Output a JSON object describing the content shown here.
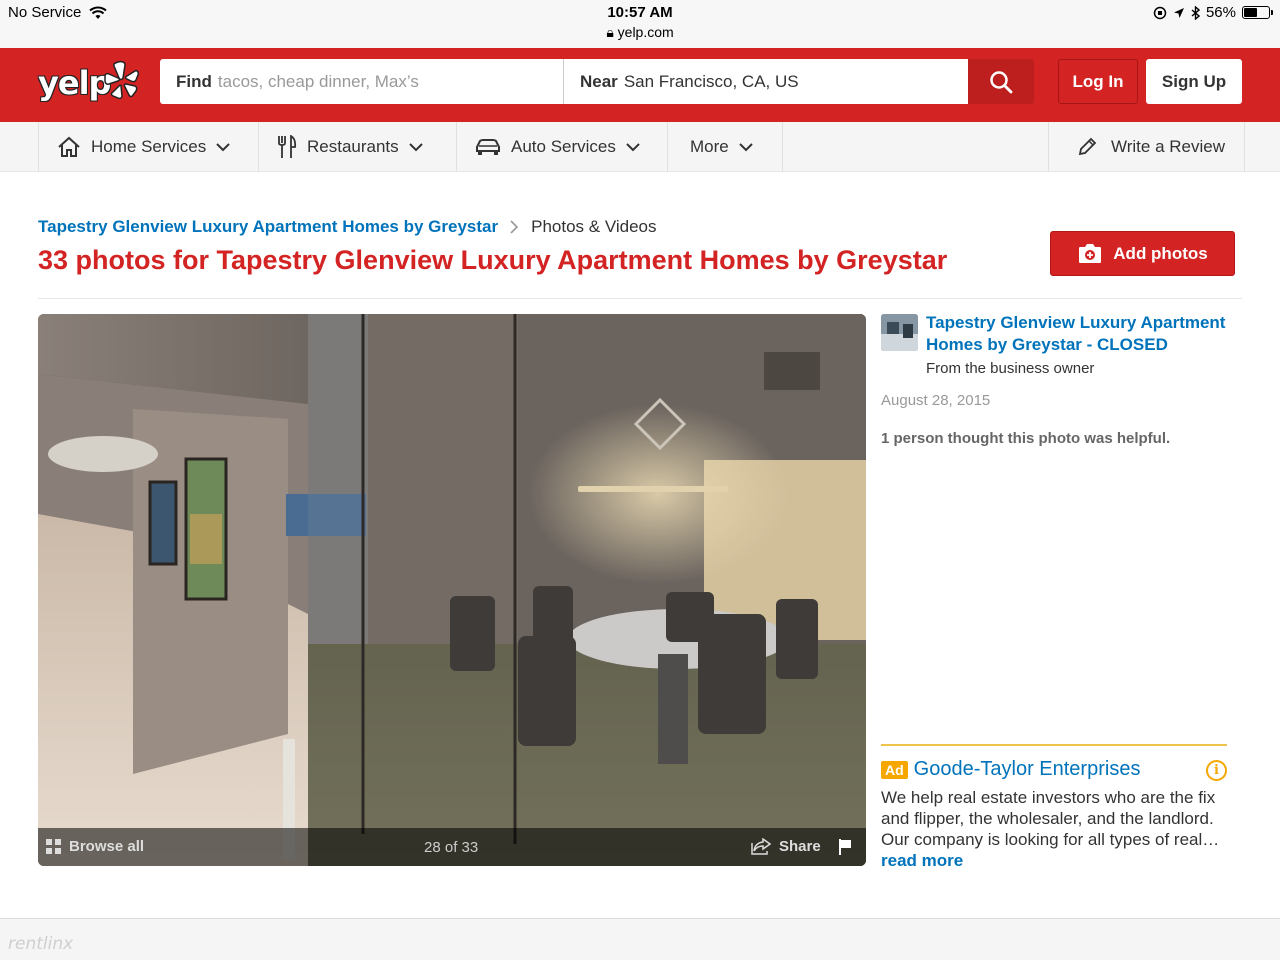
{
  "status_bar": {
    "carrier": "No Service",
    "time": "10:57 AM",
    "url": "yelp.com",
    "battery": "56%",
    "battery_level": 0.56
  },
  "header": {
    "logo": "yelp",
    "find_label": "Find",
    "find_placeholder": "tacos, cheap dinner, Max’s",
    "near_label": "Near",
    "near_value": "San Francisco, CA, US",
    "login_label": "Log In",
    "signup_label": "Sign Up"
  },
  "nav": {
    "items": [
      {
        "label": "Home Services",
        "icon": "home-icon"
      },
      {
        "label": "Restaurants",
        "icon": "fork-knife-icon"
      },
      {
        "label": "Auto Services",
        "icon": "car-icon"
      },
      {
        "label": "More",
        "icon": ""
      }
    ],
    "write_review": "Write a Review"
  },
  "breadcrumb": {
    "business": "Tapestry Glenview Luxury Apartment Homes by Greystar",
    "current": "Photos & Videos"
  },
  "page_title": "33 photos for Tapestry Glenview Luxury Apartment Homes by Greystar",
  "add_photos_label": "Add photos",
  "photo_viewer": {
    "browse_all": "Browse all",
    "counter": "28 of 33",
    "share": "Share"
  },
  "photo_info": {
    "business_name": "Tapestry Glenview Luxury Apartment Homes by Greystar - CLOSED",
    "source": "From the business owner",
    "date": "August 28, 2015",
    "helpful": "1 person thought this photo was helpful."
  },
  "ad": {
    "badge": "Ad",
    "name": "Goode-Taylor Enterprises",
    "text": "We help real estate investors who are the fix and flipper, the wholesaler, and the landlord. Our company is looking for all types of real…",
    "read_more": "read more",
    "info_icon": "i"
  },
  "watermark": "rentlinx"
}
